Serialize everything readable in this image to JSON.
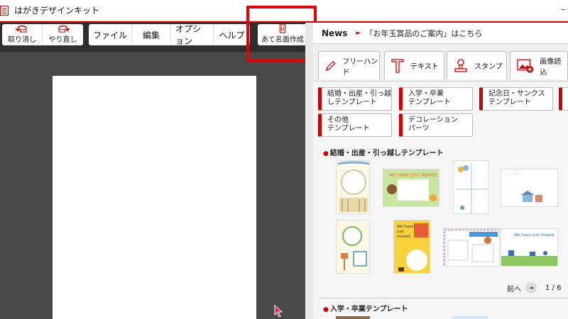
{
  "window": {
    "title": "はがきデザインキット",
    "minimize_glyph": "–"
  },
  "toolbar": {
    "undo_label": "取り消し",
    "redo_label": "やり直し",
    "menus": [
      "ファイル",
      "編集",
      "オプション",
      "ヘルプ"
    ],
    "address_make_label": "あて名面作成"
  },
  "news": {
    "label": "News",
    "arrow": "►",
    "text": "「お年玉賞品のご案内」はこちら"
  },
  "tools": {
    "freehand": "フリーハンド",
    "text": "テキスト",
    "stamp": "スタンプ",
    "image": "画像読込"
  },
  "categories": [
    {
      "line1": "結婚・出産・引っ越",
      "line2": "しテンプレート"
    },
    {
      "line1": "入学・卒業",
      "line2": "テンプレート"
    },
    {
      "line1": "記念日・サンクス",
      "line2": "テンプレート"
    },
    {
      "line1": "",
      "line2": ""
    },
    {
      "line1": "その他",
      "line2": "テンプレート"
    },
    {
      "line1": "デコレーション",
      "line2": "パーツ"
    }
  ],
  "templates": {
    "section1_title": "結婚・出産・引っ越しテンプレート",
    "section2_title": "入学・卒業テンプレート",
    "thumb_texts": {
      "t2": "WE HAVE JUST MOVED",
      "t6a": "We have",
      "t6b": "just",
      "t6c": "moved",
      "t8": "We have just moved"
    },
    "pager_prev": "前へ",
    "pager_page": "1 / 6"
  },
  "colors": {
    "accent_red": "#d40000",
    "highlight_red": "#e60000",
    "dark_bg": "#2d2d2d",
    "canvas_bg": "#4a4a4a"
  }
}
